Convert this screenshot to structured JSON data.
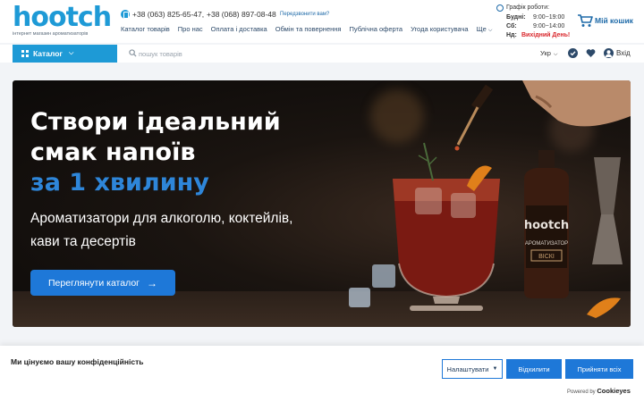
{
  "header": {
    "logo_word": "hootch",
    "logo_tagline": "інтернет магазин ароматизаторів",
    "phone_1": "+38 (063) 825-65-47,",
    "phone_2": "+38 (068) 897-08-48",
    "callback": "Передзвонити вам?",
    "nav": [
      "Каталог товарів",
      "Про нас",
      "Оплата і доставка",
      "Обмін та повернення",
      "Публічна оферта",
      "Угода користувача",
      "Ще"
    ],
    "schedule": {
      "title": "Графік роботи:",
      "rows": [
        {
          "day": "Будні:",
          "time": "9:00−19:00"
        },
        {
          "day": "Сб:",
          "time": "9:00−14:00"
        },
        {
          "day": "Нд:",
          "time": "Вихідний День!"
        }
      ]
    },
    "cart_label": "Мій кошик"
  },
  "toolbar": {
    "catalog_label": "Каталог",
    "search_placeholder": "пошук товарів",
    "language": "Укр",
    "login": "Вхід"
  },
  "hero": {
    "title_line_1": "Створи ідеальний",
    "title_line_2": "смак напоїв",
    "title_accent": "за 1 хвилину",
    "subtitle_line_1": "Ароматизатори для алкоголю, коктейлів,",
    "subtitle_line_2": "кави та десертів",
    "button_label": "Переглянути каталог",
    "bottle_brand": "hootch",
    "bottle_line_1": "АРОМАТИЗАТОР",
    "bottle_line_2": "ВІСКІ"
  },
  "cookie": {
    "text": "Ми цінуємо вашу конфіденційність",
    "settings_label": "Налаштувати",
    "reject_label": "Відхилити",
    "accept_label": "Прийняти всіх",
    "powered_prefix": "Powered by",
    "powered_brand": "Cookieyes"
  },
  "colors": {
    "brand_blue": "#1e9ad6",
    "button_blue": "#1e78d8",
    "accent_text": "#2e86d9",
    "day_off_red": "#d9262b"
  }
}
